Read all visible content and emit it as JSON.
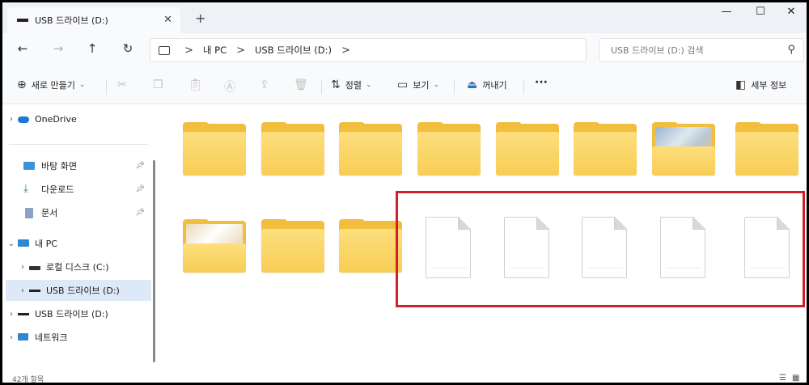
{
  "window": {
    "tab_title": "USB 드라이브 (D:)",
    "tab_close": "✕",
    "new_tab": "+",
    "minimize": "—",
    "maximize": "☐",
    "close": "✕"
  },
  "navigation": {
    "back": "←",
    "forward": "→",
    "up": "↑",
    "refresh": "↻",
    "breadcrumb": [
      "내 PC",
      "USB 드라이브 (D:)"
    ],
    "separator": ">",
    "search_placeholder": "USB 드라이브 (D:) 검색"
  },
  "toolbar": {
    "new_label": "새로 만들기",
    "sort_label": "정렬",
    "view_label": "보기",
    "eject_label": "꺼내기",
    "more_label": "···",
    "details_label": "세부 정보"
  },
  "sidebar": {
    "onedrive": "OneDrive",
    "desktop": "바탕 화면",
    "downloads": "다운로드",
    "documents": "문서",
    "this_pc": "내 PC",
    "local_disk": "로컬 디스크 (C:)",
    "usb_selected": "USB 드라이브 (D:)",
    "usb": "USB 드라이브 (D:)",
    "network": "네트워크"
  },
  "content": {
    "row1": [
      "folder",
      "folder",
      "folder",
      "folder",
      "folder",
      "folder",
      "folder-photo",
      "folder"
    ],
    "row2": [
      "folder-photo",
      "folder",
      "folder",
      "file",
      "file",
      "file",
      "file",
      "file"
    ]
  },
  "status": {
    "item_count": "42개 항목"
  },
  "colors": {
    "folder": "#f8cd55",
    "selection": "#dde9f7",
    "highlight_box": "#d2202a"
  }
}
